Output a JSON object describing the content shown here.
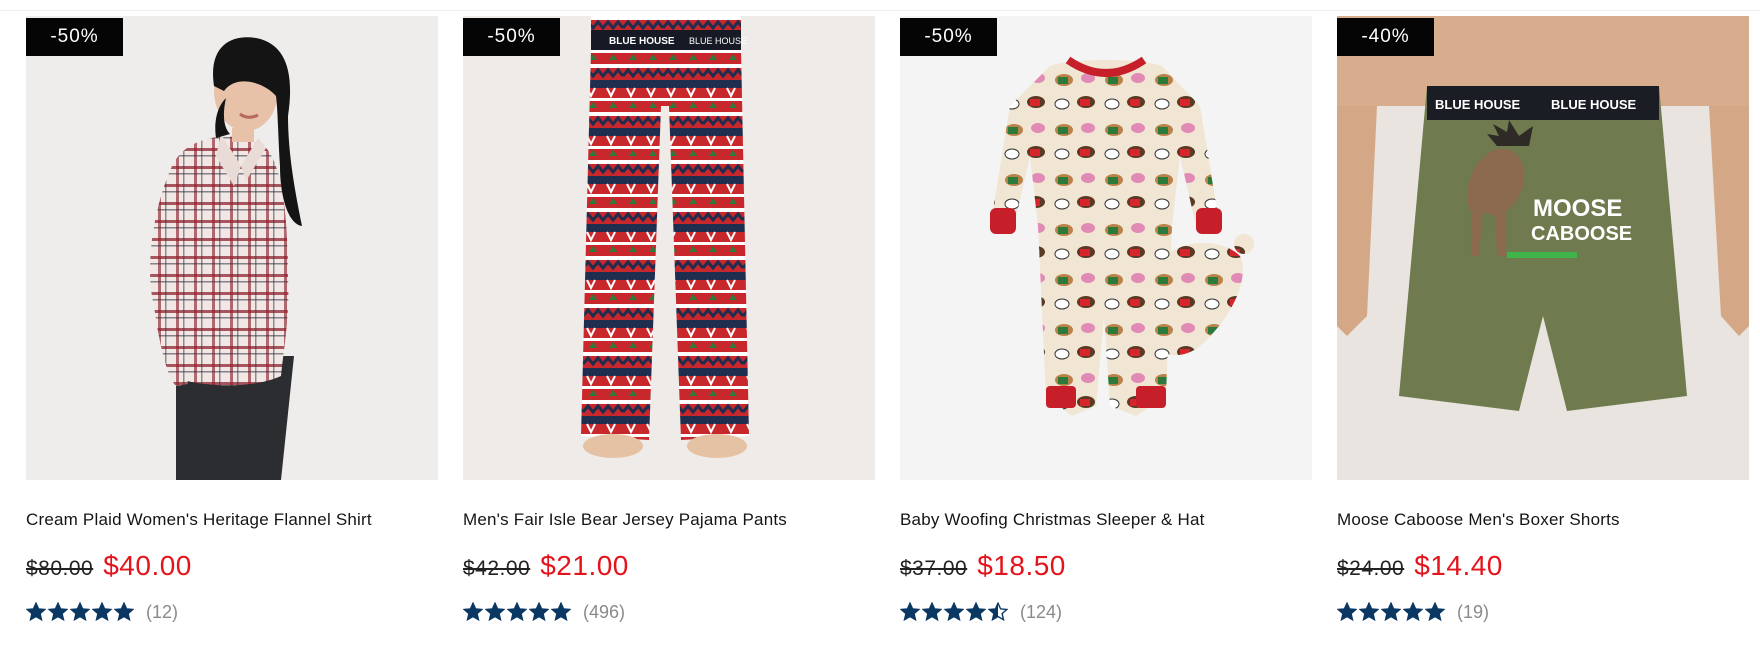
{
  "colors": {
    "sale_price": "#e3141b",
    "star": "#0b3763",
    "badge_bg": "#050505",
    "count_text": "#8a8a8a"
  },
  "products": [
    {
      "badge": "-50%",
      "title": "Cream Plaid Women's Heritage Flannel Shirt",
      "old_price": "$80.00",
      "new_price": "$40.00",
      "rating": 5,
      "review_count": "(12)",
      "image": "woman-flannel-shirt-photo"
    },
    {
      "badge": "-50%",
      "title": "Men's Fair Isle Bear Jersey Pajama Pants",
      "old_price": "$42.00",
      "new_price": "$21.00",
      "rating": 5,
      "review_count": "(496)",
      "image": "fair-isle-pajama-pants-photo",
      "waistband_text": "BLUE HOUSE"
    },
    {
      "badge": "-50%",
      "title": "Baby Woofing Christmas Sleeper & Hat",
      "old_price": "$37.00",
      "new_price": "$18.50",
      "rating": 4.5,
      "review_count": "(124)",
      "image": "baby-dog-sleeper-photo"
    },
    {
      "badge": "-40%",
      "title": "Moose Caboose Men's Boxer Shorts",
      "old_price": "$24.00",
      "new_price": "$14.40",
      "rating": 5,
      "review_count": "(19)",
      "image": "moose-boxer-shorts-photo",
      "waistband_text": "BLUE HOUSE",
      "graphic_text_line1": "MOOSE",
      "graphic_text_line2": "CABOOSE"
    }
  ]
}
